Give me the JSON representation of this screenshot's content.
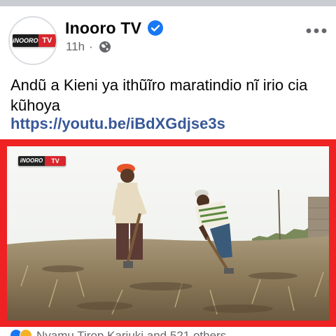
{
  "post": {
    "page_name": "Inooro TV",
    "verified": true,
    "time": "11h",
    "dot": "·",
    "text": "Andũ a  Kieni ya ithũĩro maratindio nĩ irio cia kũhoya",
    "link": "https://youtu.be/iBdXGdjse3s"
  },
  "avatar": {
    "logo_left": "iNOORO",
    "logo_right": "TV"
  },
  "video": {
    "watermark_left": "iNOORO",
    "watermark_right": "TV"
  },
  "reactions": {
    "icons": [
      "like",
      "haha"
    ],
    "text": "Nyamu Tirop Kariuki and 521 others"
  },
  "icons": {
    "verified": "verified-badge-icon",
    "audience": "globe-icon",
    "menu": "more-options-icon"
  },
  "colors": {
    "frame": "#ee2222",
    "link": "#385898",
    "verified": "#1877f2",
    "meta": "#65676b"
  }
}
